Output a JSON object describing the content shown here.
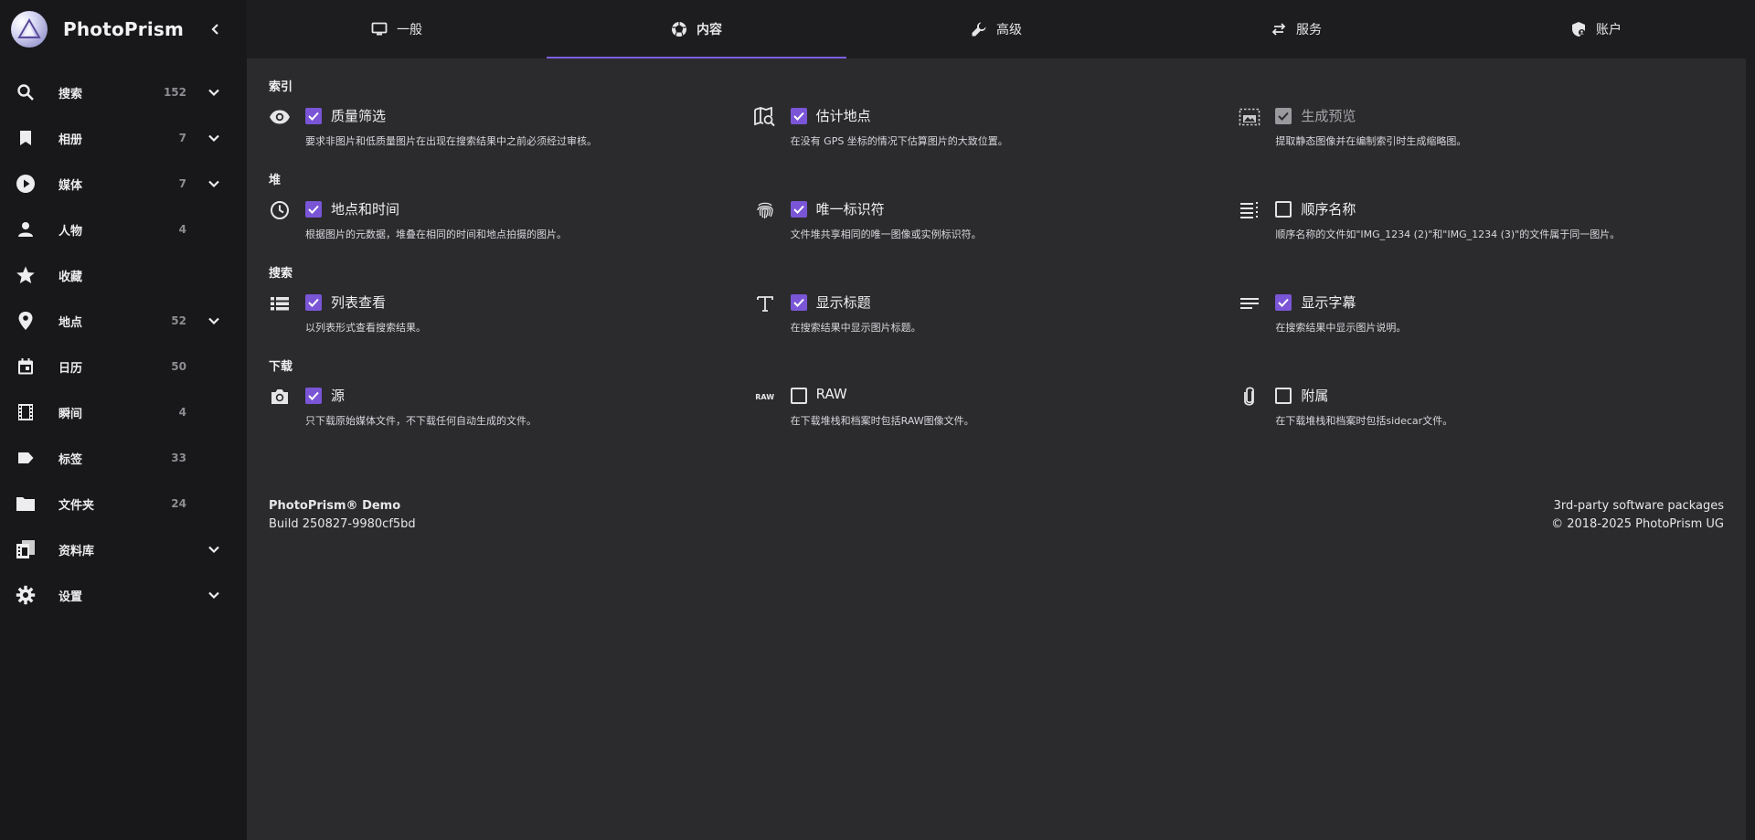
{
  "app": {
    "name": "PhotoPrism"
  },
  "sidebar": {
    "items": [
      {
        "label": "搜索",
        "count": "152",
        "icon": "search-icon",
        "expandable": true
      },
      {
        "label": "相册",
        "count": "7",
        "icon": "bookmark-icon",
        "expandable": true
      },
      {
        "label": "媒体",
        "count": "7",
        "icon": "play-circle-icon",
        "expandable": true
      },
      {
        "label": "人物",
        "count": "4",
        "icon": "person-icon",
        "expandable": false
      },
      {
        "label": "收藏",
        "count": "",
        "icon": "star-icon",
        "expandable": false
      },
      {
        "label": "地点",
        "count": "52",
        "icon": "map-pin-icon",
        "expandable": true
      },
      {
        "label": "日历",
        "count": "50",
        "icon": "calendar-icon",
        "expandable": false
      },
      {
        "label": "瞬间",
        "count": "4",
        "icon": "film-icon",
        "expandable": false
      },
      {
        "label": "标签",
        "count": "33",
        "icon": "label-icon",
        "expandable": false
      },
      {
        "label": "文件夹",
        "count": "24",
        "icon": "folder-icon",
        "expandable": false
      },
      {
        "label": "资料库",
        "count": "",
        "icon": "library-icon",
        "expandable": true
      },
      {
        "label": "设置",
        "count": "",
        "icon": "gear-icon",
        "expandable": true
      }
    ]
  },
  "tabs": [
    {
      "label": "一般",
      "icon": "monitor-icon",
      "active": false
    },
    {
      "label": "内容",
      "icon": "aperture-icon",
      "active": true
    },
    {
      "label": "高级",
      "icon": "wrench-icon",
      "active": false
    },
    {
      "label": "服务",
      "icon": "sync-arrows-icon",
      "active": false
    },
    {
      "label": "账户",
      "icon": "shield-account-icon",
      "active": false
    }
  ],
  "sections": [
    {
      "title": "索引",
      "options": [
        {
          "label": "质量筛选",
          "desc": "要求非图片和低质量图片在出现在搜索结果中之前必须经过审核。",
          "checked": true,
          "muted": false,
          "icon": "eye-icon"
        },
        {
          "label": "估计地点",
          "desc": "在没有 GPS 坐标的情况下估算图片的大致位置。",
          "checked": true,
          "muted": false,
          "icon": "map-search-icon"
        },
        {
          "label": "生成预览",
          "desc": "提取静态图像并在编制索引时生成缩略图。",
          "checked": true,
          "muted": true,
          "icon": "image-frame-icon"
        }
      ]
    },
    {
      "title": "堆",
      "options": [
        {
          "label": "地点和时间",
          "desc": "根据图片的元数据，堆叠在相同的时间和地点拍摄的图片。",
          "checked": true,
          "muted": false,
          "icon": "clock-icon"
        },
        {
          "label": "唯一标识符",
          "desc": "文件堆共享相同的唯一图像或实例标识符。",
          "checked": true,
          "muted": false,
          "icon": "fingerprint-icon"
        },
        {
          "label": "顺序名称",
          "desc": "顺序名称的文件如\"IMG_1234 (2)\"和\"IMG_1234 (3)\"的文件属于同一图片。",
          "checked": false,
          "muted": false,
          "icon": "list-numbered-icon"
        }
      ]
    },
    {
      "title": "搜索",
      "options": [
        {
          "label": "列表查看",
          "desc": "以列表形式查看搜索结果。",
          "checked": true,
          "muted": false,
          "icon": "view-list-icon"
        },
        {
          "label": "显示标题",
          "desc": "在搜索结果中显示图片标题。",
          "checked": true,
          "muted": false,
          "icon": "text-title-icon"
        },
        {
          "label": "显示字幕",
          "desc": "在搜索结果中显示图片说明。",
          "checked": true,
          "muted": false,
          "icon": "text-lines-icon"
        }
      ]
    },
    {
      "title": "下载",
      "options": [
        {
          "label": "源",
          "desc": "只下载原始媒体文件，不下载任何自动生成的文件。",
          "checked": true,
          "muted": false,
          "icon": "camera-icon"
        },
        {
          "label": "RAW",
          "desc": "在下载堆栈和档案时包括RAW图像文件。",
          "checked": false,
          "muted": false,
          "icon": "raw-icon",
          "icon_text": "RAW"
        },
        {
          "label": "附属",
          "desc": "在下载堆栈和档案时包括sidecar文件。",
          "checked": false,
          "muted": false,
          "icon": "paperclip-icon"
        }
      ]
    }
  ],
  "footer": {
    "product": "PhotoPrism® Demo",
    "build": "Build 250827-9980cf5bd",
    "packages": "3rd-party software packages",
    "copyright": "© 2018-2025 PhotoPrism UG"
  },
  "colors": {
    "accent": "#7c5ee0",
    "checkbox": "#7a55d6",
    "sidebar_bg": "#18181a",
    "content_bg": "#2b2b2e",
    "tabs_bg": "#1d1d1f"
  }
}
